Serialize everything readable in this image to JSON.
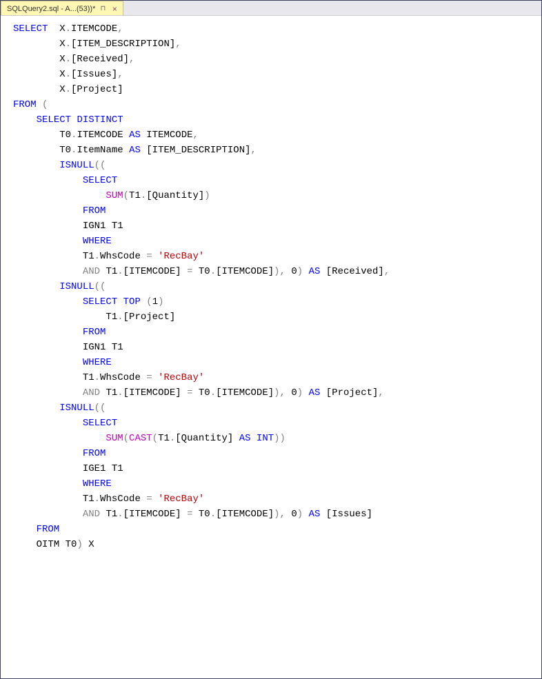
{
  "tab": {
    "title": "SQLQuery2.sql - A...(53))*"
  },
  "code": {
    "t1": "SELECT",
    "t2": "X",
    "t3": "ITEMCODE",
    "t4": "[ITEM_DESCRIPTION]",
    "t5": "[Received]",
    "t6": "[Issues]",
    "t7": "[Project]",
    "t8": "FROM",
    "t9": "DISTINCT",
    "t10": "T0",
    "t11": "AS",
    "t12": "ItemName",
    "t13": "ISNULL",
    "t14": "SUM",
    "t15": "T1",
    "t16": "[Quantity]",
    "t17": "IGN1",
    "t18": "WHERE",
    "t19": "WhsCode",
    "t20": "'RecBay'",
    "t21": "AND",
    "t22": "[ITEMCODE]",
    "t23": "0",
    "t24": "TOP",
    "t25": "1",
    "t26": "CAST",
    "t27": "INT",
    "t28": "IGE1",
    "t29": "OITM",
    "eq": "=",
    "dot": ".",
    "com": ",",
    "lp": "(",
    "rp": ")",
    "lpp": "((",
    "rpp": "))",
    "rppc": ")),"
  }
}
